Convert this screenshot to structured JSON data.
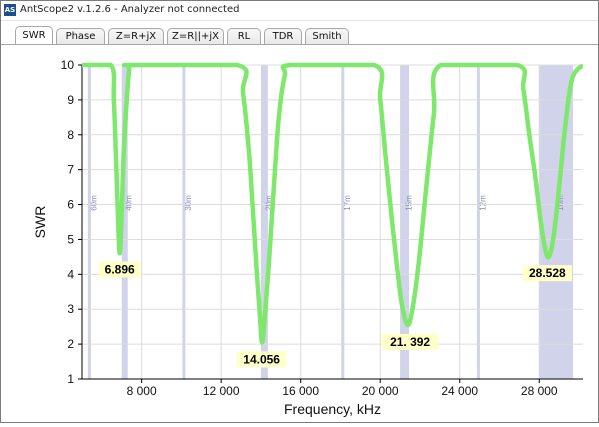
{
  "window": {
    "title": "AntScope2 v.1.2.6 - Analyzer not connected",
    "icon": "AS"
  },
  "tabs": [
    {
      "label": "SWR",
      "active": true
    },
    {
      "label": "Phase"
    },
    {
      "label": "Z=R+jX"
    },
    {
      "label": "Z=R||+jX"
    },
    {
      "label": "RL"
    },
    {
      "label": "TDR"
    },
    {
      "label": "Smith"
    }
  ],
  "colors": {
    "curve": "#7de86b",
    "band": "#d0d3ea",
    "marker_bg": "#ffffc8"
  },
  "chart_data": {
    "type": "line",
    "title": "",
    "xlabel": "Frequency, kHz",
    "ylabel": "SWR",
    "xlim": [
      5000,
      30200
    ],
    "ylim": [
      1,
      10
    ],
    "x_ticks": [
      8000,
      12000,
      16000,
      20000,
      24000,
      28000
    ],
    "x_tick_labels": [
      "8 000",
      "12 000",
      "16 000",
      "20 000",
      "24 000",
      "28 000"
    ],
    "y_ticks": [
      1,
      2,
      3,
      4,
      5,
      6,
      7,
      8,
      9,
      10
    ],
    "y_tick_labels": [
      "1",
      "2",
      "3",
      "4",
      "5",
      "6",
      "7",
      "8",
      "9",
      "10"
    ],
    "grid": true,
    "bands": [
      {
        "label": "60m",
        "start": 5330,
        "end": 5410
      },
      {
        "label": "40m",
        "start": 7000,
        "end": 7300
      },
      {
        "label": "30m",
        "start": 10100,
        "end": 10150
      },
      {
        "label": "20m",
        "start": 14000,
        "end": 14350
      },
      {
        "label": "17m",
        "start": 18068,
        "end": 18168
      },
      {
        "label": "15m",
        "start": 21000,
        "end": 21450
      },
      {
        "label": "12m",
        "start": 24890,
        "end": 24990
      },
      {
        "label": "10m",
        "start": 28000,
        "end": 29700
      }
    ],
    "series": [
      {
        "x": [
          5000,
          6450,
          6600,
          6700,
          6800,
          6850,
          6896,
          6950,
          7000,
          7100,
          7250,
          7400,
          7550,
          12800,
          13100,
          13400,
          13600,
          13800,
          13950,
          14056,
          14200,
          14400,
          14650,
          14900,
          15200,
          15500,
          19700,
          20000,
          20300,
          20600,
          20850,
          21100,
          21392,
          21650,
          21950,
          22300,
          22700,
          23050,
          26900,
          27200,
          27500,
          27800,
          28100,
          28350,
          28528,
          28750,
          29000,
          29300,
          29650,
          30200
        ],
        "y": [
          10,
          10,
          9,
          7.5,
          5.8,
          5,
          4.6,
          5,
          5.8,
          7.5,
          9,
          10,
          10,
          10,
          9.2,
          7.5,
          5.8,
          4,
          2.8,
          2.05,
          2.8,
          4.3,
          6.5,
          8.5,
          9.7,
          10,
          10,
          9,
          7.2,
          5.5,
          4.2,
          3.1,
          2.55,
          3.1,
          4.4,
          6.4,
          8.6,
          10,
          10,
          9.3,
          8,
          6.8,
          5.4,
          4.6,
          4.55,
          5.2,
          6.5,
          8.2,
          9.6,
          10
        ]
      }
    ],
    "markers": [
      {
        "x": 6896,
        "y": 4.6,
        "label": "6.896"
      },
      {
        "x": 14056,
        "y": 2.05,
        "label": "14.056"
      },
      {
        "x": 21392,
        "y": 2.55,
        "label": "21. 392"
      },
      {
        "x": 28528,
        "y": 4.55,
        "label": "28.528"
      }
    ]
  }
}
